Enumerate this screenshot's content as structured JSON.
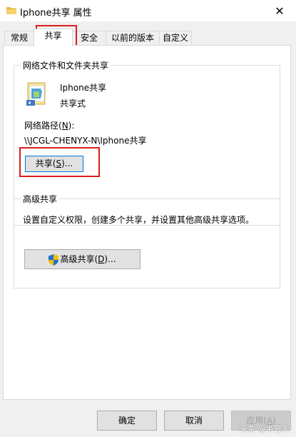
{
  "window": {
    "title": "Iphone共享 属性",
    "close_glyph": "✕"
  },
  "tabs": [
    {
      "label": "常规"
    },
    {
      "label": "共享"
    },
    {
      "label": "安全"
    },
    {
      "label": "以前的版本"
    },
    {
      "label": "自定义"
    }
  ],
  "network_share": {
    "group_title": "网络文件和文件夹共享",
    "folder_name": "Iphone共享",
    "share_status": "共享式",
    "path_label_pre": "网络路径(",
    "path_label_key": "N",
    "path_label_post": "):",
    "path_value": "\\\\JCGL-CHENYX-N\\Iphone共享",
    "share_button_pre": "共享(",
    "share_button_key": "S",
    "share_button_post": ")..."
  },
  "advanced_share": {
    "group_title": "高级共享",
    "description": "设置自定义权限，创建多个共享，并设置其他高级共享选项。",
    "button_pre": "高级共享(",
    "button_key": "D",
    "button_post": ")..."
  },
  "footer": {
    "ok_label": "确定",
    "cancel_label": "取消",
    "apply_pre": "应用(",
    "apply_key": "A",
    "apply_post": ")"
  },
  "watermark": "头条 @半穷人",
  "colors": {
    "highlight_box": "#d81e1e",
    "folder_icon": "#e8b830",
    "shield_blue": "#1f6fd1",
    "shield_yellow": "#f2c200"
  }
}
